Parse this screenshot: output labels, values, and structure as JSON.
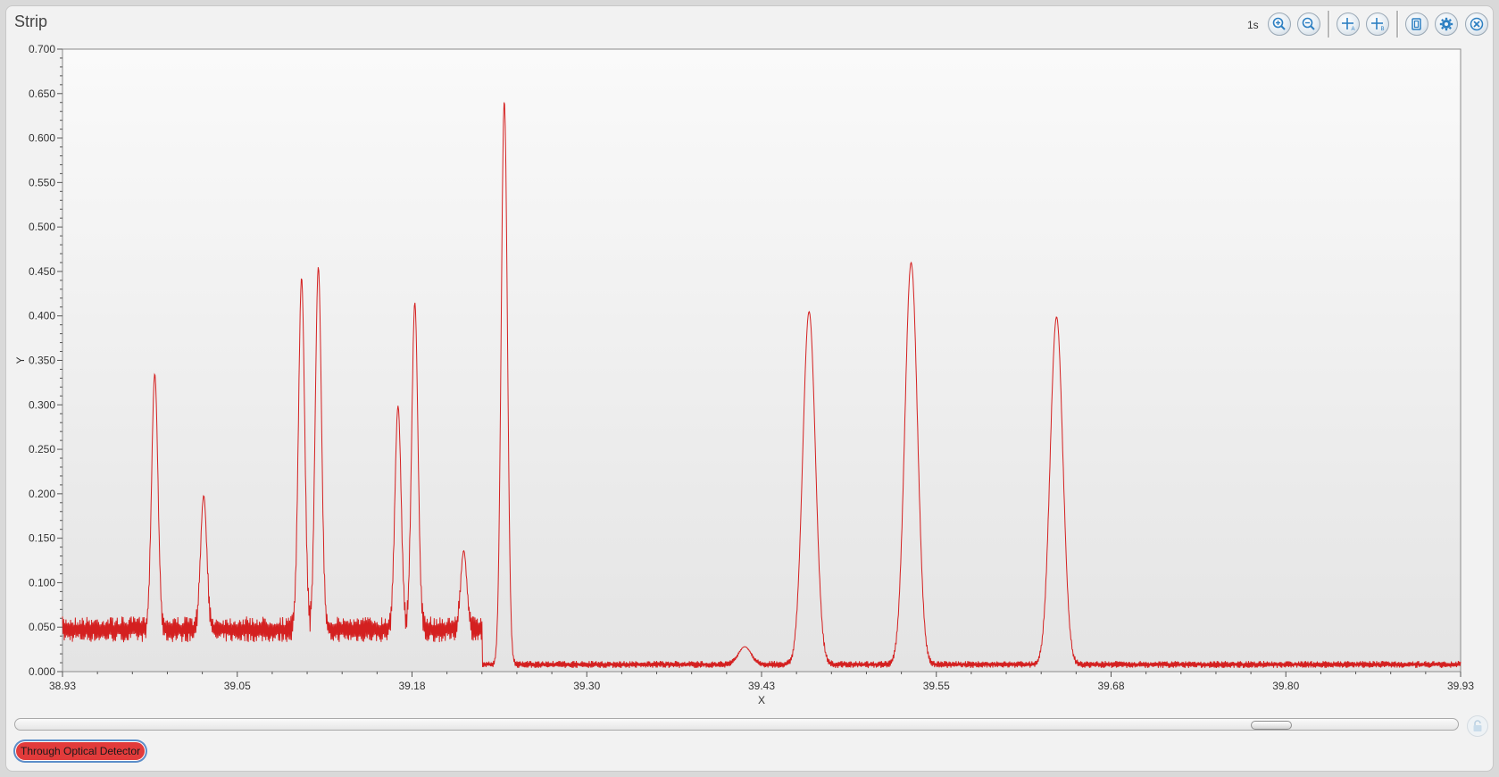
{
  "window": {
    "title": "Strip"
  },
  "toolbar": {
    "interval_label": "1s",
    "buttons": [
      {
        "name": "zoom-in-button",
        "icon": "zoom-in-icon"
      },
      {
        "name": "zoom-out-button",
        "icon": "zoom-out-icon"
      },
      {
        "name": "cursor-a-button",
        "icon": "cursor-a-icon",
        "letter": "A"
      },
      {
        "name": "cursor-b-button",
        "icon": "cursor-b-icon",
        "letter": "B"
      },
      {
        "name": "copy-button",
        "icon": "copy-icon"
      },
      {
        "name": "settings-button",
        "icon": "gear-icon"
      },
      {
        "name": "close-button",
        "icon": "close-icon"
      }
    ]
  },
  "chart_data": {
    "type": "line",
    "xlabel": "X",
    "ylabel": "Y",
    "xlim": [
      38.93,
      39.93
    ],
    "ylim": [
      0,
      0.7
    ],
    "x_ticks": [
      "38.93",
      "39.05",
      "39.18",
      "39.30",
      "39.43",
      "39.55",
      "39.68",
      "39.80",
      "39.93"
    ],
    "y_ticks": [
      "0.000",
      "0.050",
      "0.100",
      "0.150",
      "0.200",
      "0.250",
      "0.300",
      "0.350",
      "0.400",
      "0.450",
      "0.500",
      "0.550",
      "0.600",
      "0.650",
      "0.700"
    ],
    "grid": false,
    "series": [
      {
        "name": "Through Optical Detector",
        "color": "#d42020",
        "noise": [
          {
            "x_start": 38.93,
            "x_end": 39.23,
            "low": 0.033,
            "high": 0.062
          },
          {
            "x_start": 39.23,
            "x_end": 39.93,
            "low": 0.004,
            "high": 0.012
          }
        ],
        "peaks": [
          {
            "x": 38.996,
            "y": 0.335
          },
          {
            "x": 39.031,
            "y": 0.198
          },
          {
            "x": 39.101,
            "y": 0.443
          },
          {
            "x": 39.113,
            "y": 0.455
          },
          {
            "x": 39.17,
            "y": 0.299
          },
          {
            "x": 39.182,
            "y": 0.415
          },
          {
            "x": 39.217,
            "y": 0.136
          },
          {
            "x": 39.246,
            "y": 0.642
          },
          {
            "x": 39.418,
            "y": 0.028
          },
          {
            "x": 39.464,
            "y": 0.405
          },
          {
            "x": 39.537,
            "y": 0.46
          },
          {
            "x": 39.641,
            "y": 0.399
          }
        ]
      }
    ]
  },
  "scrollbar": {
    "position": 0.88
  },
  "legend": {
    "items": [
      {
        "label": "Through Optical Detector",
        "color": "#e23b3b"
      }
    ]
  }
}
